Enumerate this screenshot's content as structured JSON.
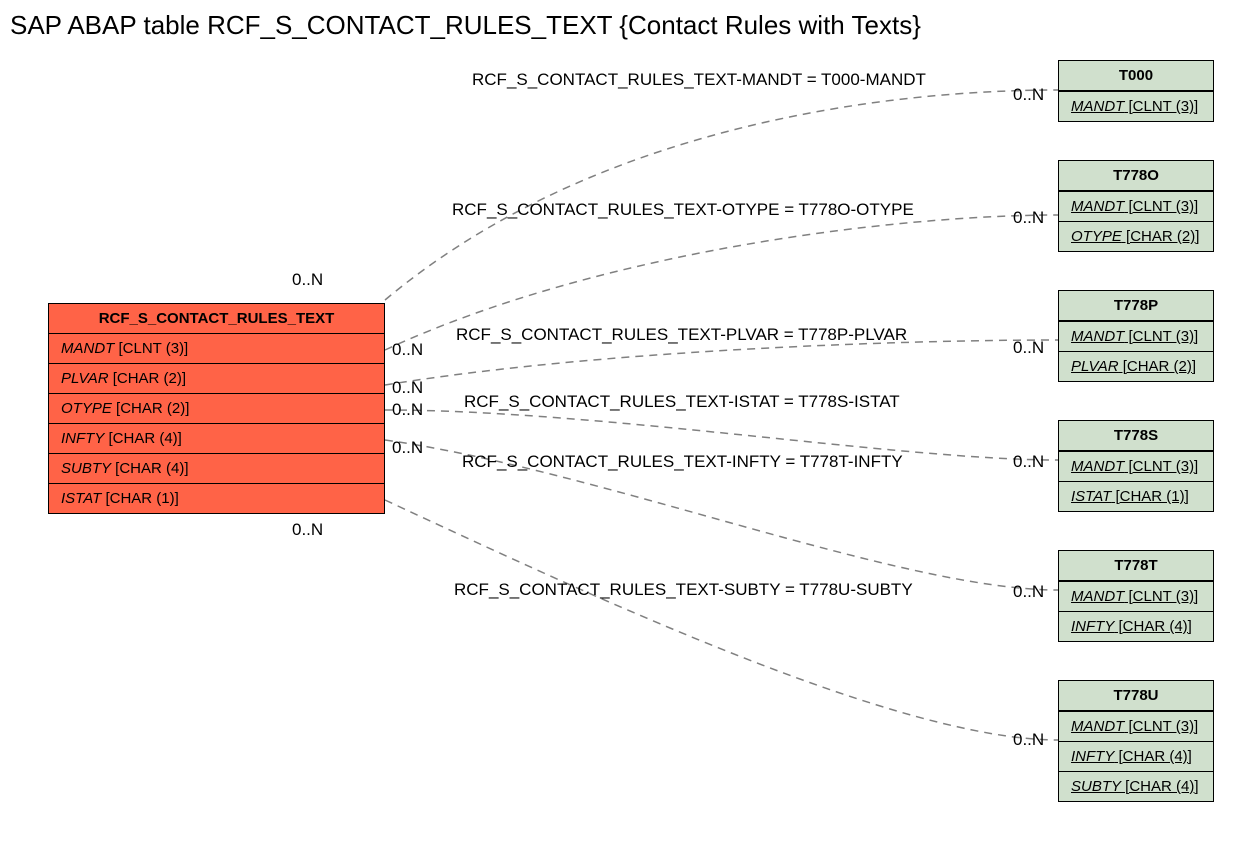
{
  "title": "SAP ABAP table RCF_S_CONTACT_RULES_TEXT {Contact Rules with Texts}",
  "mainTable": {
    "name": "RCF_S_CONTACT_RULES_TEXT",
    "fields": [
      {
        "name": "MANDT",
        "type": "[CLNT (3)]",
        "key": false
      },
      {
        "name": "PLVAR",
        "type": "[CHAR (2)]",
        "key": false
      },
      {
        "name": "OTYPE",
        "type": "[CHAR (2)]",
        "key": false
      },
      {
        "name": "INFTY",
        "type": "[CHAR (4)]",
        "key": false
      },
      {
        "name": "SUBTY",
        "type": "[CHAR (4)]",
        "key": false
      },
      {
        "name": "ISTAT",
        "type": "[CHAR (1)]",
        "key": false
      }
    ]
  },
  "refTables": [
    {
      "name": "T000",
      "fields": [
        {
          "name": "MANDT",
          "type": "[CLNT (3)]",
          "key": true
        }
      ]
    },
    {
      "name": "T778O",
      "fields": [
        {
          "name": "MANDT",
          "type": "[CLNT (3)]",
          "key": true
        },
        {
          "name": "OTYPE",
          "type": "[CHAR (2)]",
          "key": true
        }
      ]
    },
    {
      "name": "T778P",
      "fields": [
        {
          "name": "MANDT",
          "type": "[CLNT (3)]",
          "key": true
        },
        {
          "name": "PLVAR",
          "type": "[CHAR (2)]",
          "key": true
        }
      ]
    },
    {
      "name": "T778S",
      "fields": [
        {
          "name": "MANDT",
          "type": "[CLNT (3)]",
          "key": true
        },
        {
          "name": "ISTAT",
          "type": "[CHAR (1)]",
          "key": true
        }
      ]
    },
    {
      "name": "T778T",
      "fields": [
        {
          "name": "MANDT",
          "type": "[CLNT (3)]",
          "key": true
        },
        {
          "name": "INFTY",
          "type": "[CHAR (4)]",
          "key": true
        }
      ]
    },
    {
      "name": "T778U",
      "fields": [
        {
          "name": "MANDT",
          "type": "[CLNT (3)]",
          "key": true
        },
        {
          "name": "INFTY",
          "type": "[CHAR (4)]",
          "key": true
        },
        {
          "name": "SUBTY",
          "type": "[CHAR (4)]",
          "key": true
        }
      ]
    }
  ],
  "relations": [
    {
      "text": "RCF_S_CONTACT_RULES_TEXT-MANDT = T000-MANDT"
    },
    {
      "text": "RCF_S_CONTACT_RULES_TEXT-OTYPE = T778O-OTYPE"
    },
    {
      "text": "RCF_S_CONTACT_RULES_TEXT-PLVAR = T778P-PLVAR"
    },
    {
      "text": "RCF_S_CONTACT_RULES_TEXT-ISTAT = T778S-ISTAT"
    },
    {
      "text": "RCF_S_CONTACT_RULES_TEXT-INFTY = T778T-INFTY"
    },
    {
      "text": "RCF_S_CONTACT_RULES_TEXT-SUBTY = T778U-SUBTY"
    }
  ],
  "card": {
    "srcM1": "0..N",
    "dstM1": "0..N",
    "srcM2": "0..N",
    "dstM2": "0..N",
    "srcM3": "0..N",
    "dstM3": "0..N",
    "srcM4": "0..N",
    "dstM4": "0..N",
    "srcM5": "0..N",
    "dstM5": "0..N",
    "srcM6": "0..N",
    "dstM6": "0..N"
  }
}
